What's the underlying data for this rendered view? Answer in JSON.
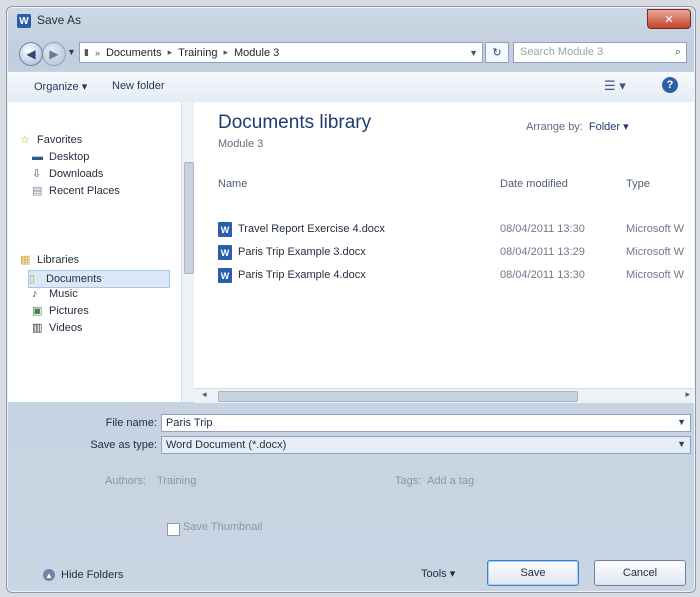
{
  "window": {
    "title": "Save As",
    "title_icon": "W",
    "close_label": "✕"
  },
  "nav": {
    "address": [
      "Documents",
      "Training",
      "Module 3"
    ],
    "search_placeholder": "Search Module 3"
  },
  "toolbar": {
    "organize": "Organize ▾",
    "new_folder": "New folder"
  },
  "sidebar": {
    "favorites": "Favorites",
    "favorites_items": [
      "Desktop",
      "Downloads",
      "Recent Places"
    ],
    "libraries": "Libraries",
    "library_items": [
      "Documents",
      "Music",
      "Pictures",
      "Videos"
    ]
  },
  "main": {
    "library_title": "Documents library",
    "library_sub": "Module 3",
    "arrange_label": "Arrange by:",
    "arrange_value": "Folder ▾",
    "columns": {
      "name": "Name",
      "date": "Date modified",
      "type": "Type"
    },
    "files": [
      {
        "name": "Travel Report Exercise 4.docx",
        "date": "08/04/2011 13:30",
        "type": "Microsoft W"
      },
      {
        "name": "Paris Trip Example 3.docx",
        "date": "08/04/2011 13:29",
        "type": "Microsoft W"
      },
      {
        "name": "Paris Trip Example 4.docx",
        "date": "08/04/2011 13:30",
        "type": "Microsoft W"
      }
    ]
  },
  "form": {
    "file_name_label": "File name:",
    "file_name_value": "Paris Trip",
    "save_type_label": "Save as type:",
    "save_type_value": "Word Document (*.docx)",
    "authors_label": "Authors:",
    "authors_value": "Training",
    "tags_label": "Tags:",
    "tags_value": "Add a tag",
    "thumbnail_label": "Save Thumbnail"
  },
  "footer": {
    "hide_folders": "Hide Folders",
    "tools": "Tools ▾",
    "save": "Save",
    "cancel": "Cancel"
  }
}
